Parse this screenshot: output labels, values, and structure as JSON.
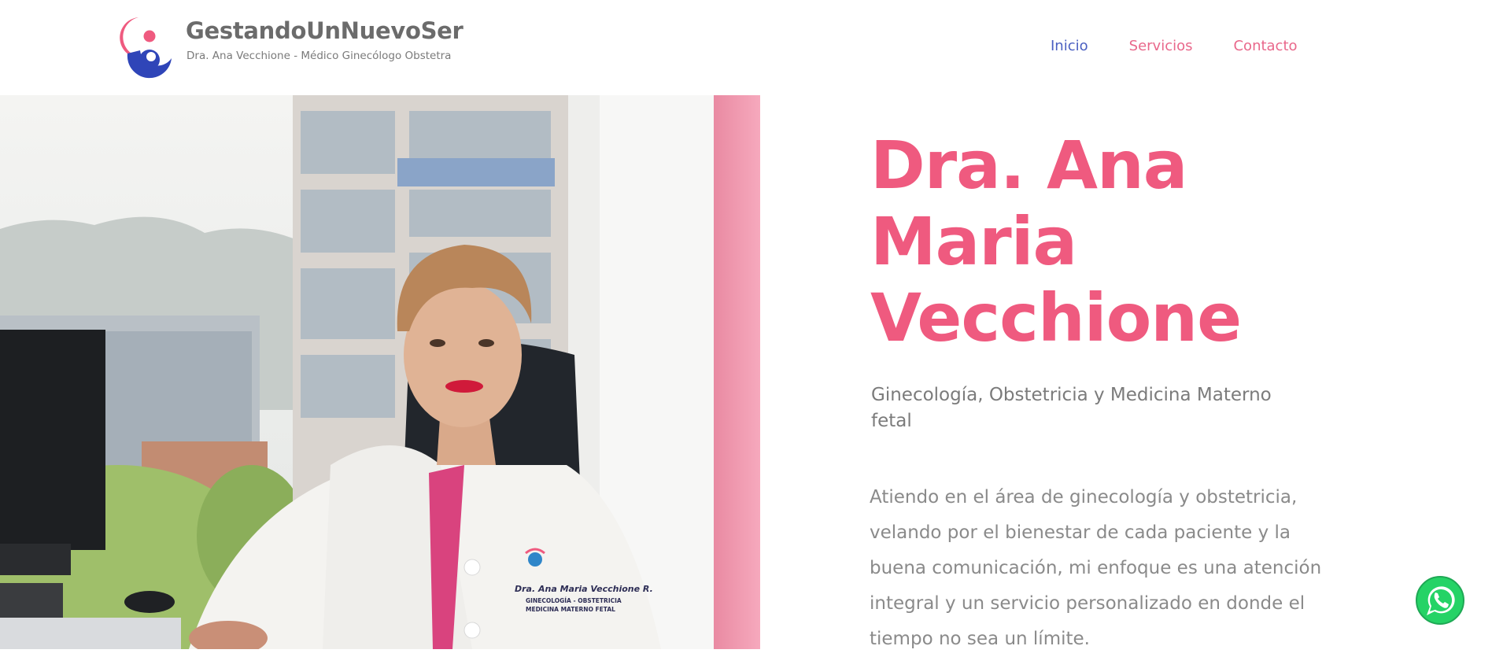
{
  "brand": {
    "title": "GestandoUnNuevoSer",
    "subtitle": "Dra. Ana Vecchione - Médico Ginecólogo Obstetra",
    "logo_icon": "mother-baby-logo-icon",
    "colors": {
      "pink": "#ef5a7f",
      "blue": "#2f45b8"
    }
  },
  "nav": {
    "items": [
      {
        "label": "Inicio",
        "active": true
      },
      {
        "label": "Servicios",
        "active": false
      },
      {
        "label": "Contacto",
        "active": false
      }
    ],
    "colors": {
      "active": "#4a5fc1",
      "default": "#e9688b"
    }
  },
  "hero": {
    "name": "Dra. Ana Maria Vecchione",
    "subtitle": "Ginecología, Obstetricia y Medicina Materno fetal",
    "description": "Atiendo en el área de ginecología y obstetricia, velando por el bienestar de cada paciente y la buena comunicación, mi enfoque es una atención integral y un servicio personalizado en donde el tiempo no sea un límite."
  },
  "photo": {
    "coat_embroidery_name": "Dra. Ana Maria Vecchione R.",
    "coat_embroidery_line1": "GINECOLOGÍA - OBSTETRICIA",
    "coat_embroidery_line2": "MEDICINA MATERNO FETAL"
  },
  "whatsapp": {
    "icon": "whatsapp-icon",
    "color": "#25d366"
  }
}
